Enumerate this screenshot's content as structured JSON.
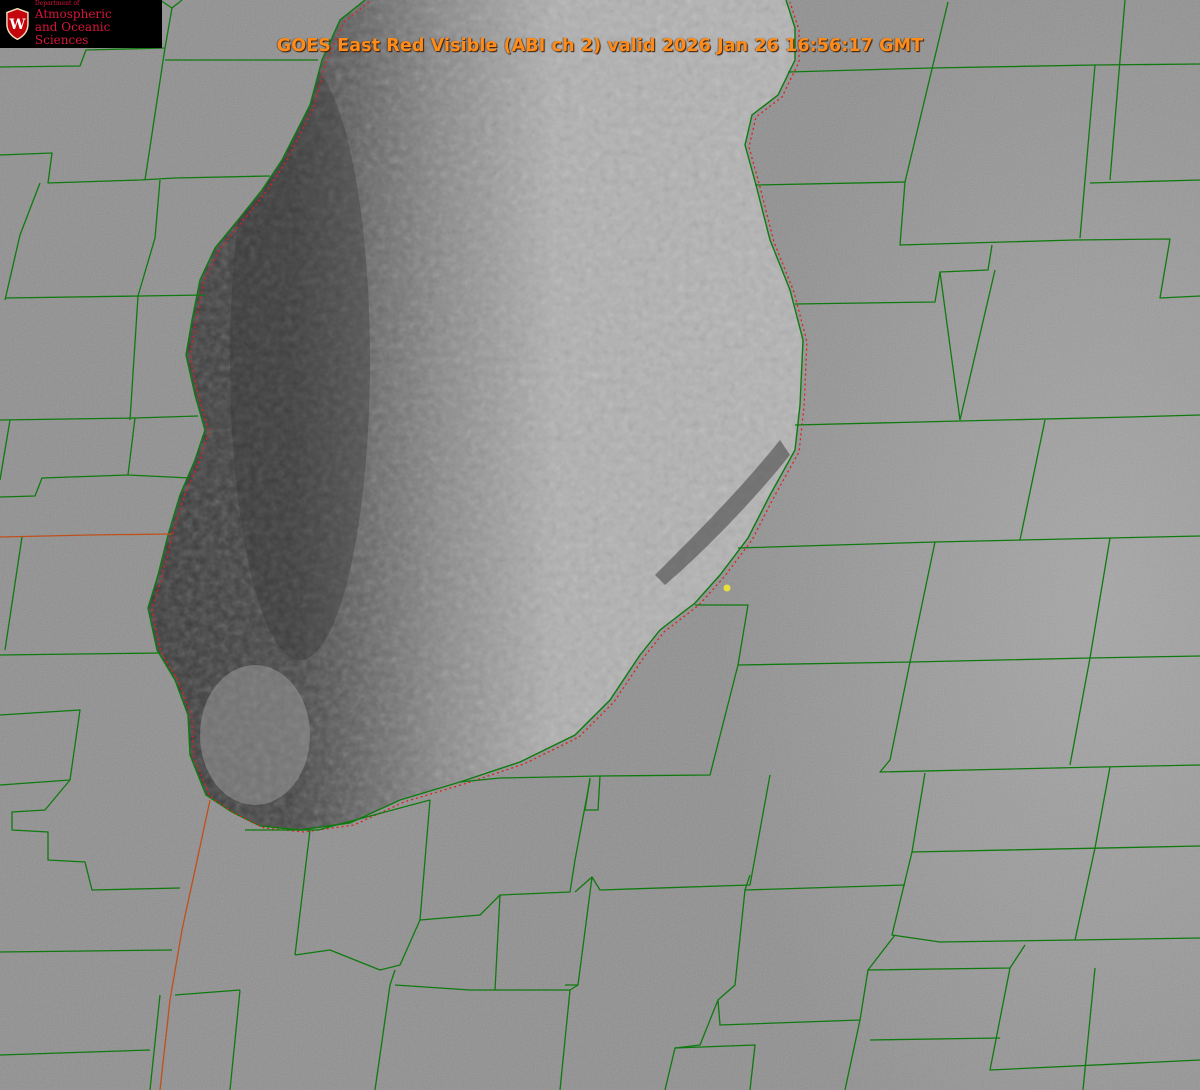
{
  "product": {
    "title": "GOES East Red Visible (ABI ch 2) valid 2026 Jan 26 16:56:17 GMT"
  },
  "logo": {
    "dept": "Department of",
    "line1": "Atmospheric",
    "line2": "and Oceanic Sciences",
    "seal_letter": "W"
  },
  "colors": {
    "land": "#8f8f8f",
    "lake_dark": "#3c3c3c",
    "lake_cloud": "#b6b6b6",
    "county_line": "#0f7a0f",
    "shoreline_dotted": "#e02020",
    "state_line": "#c0501a",
    "title": "#ff8c1a",
    "marker": "#e8e03a",
    "logo_red": "#d8143a"
  }
}
